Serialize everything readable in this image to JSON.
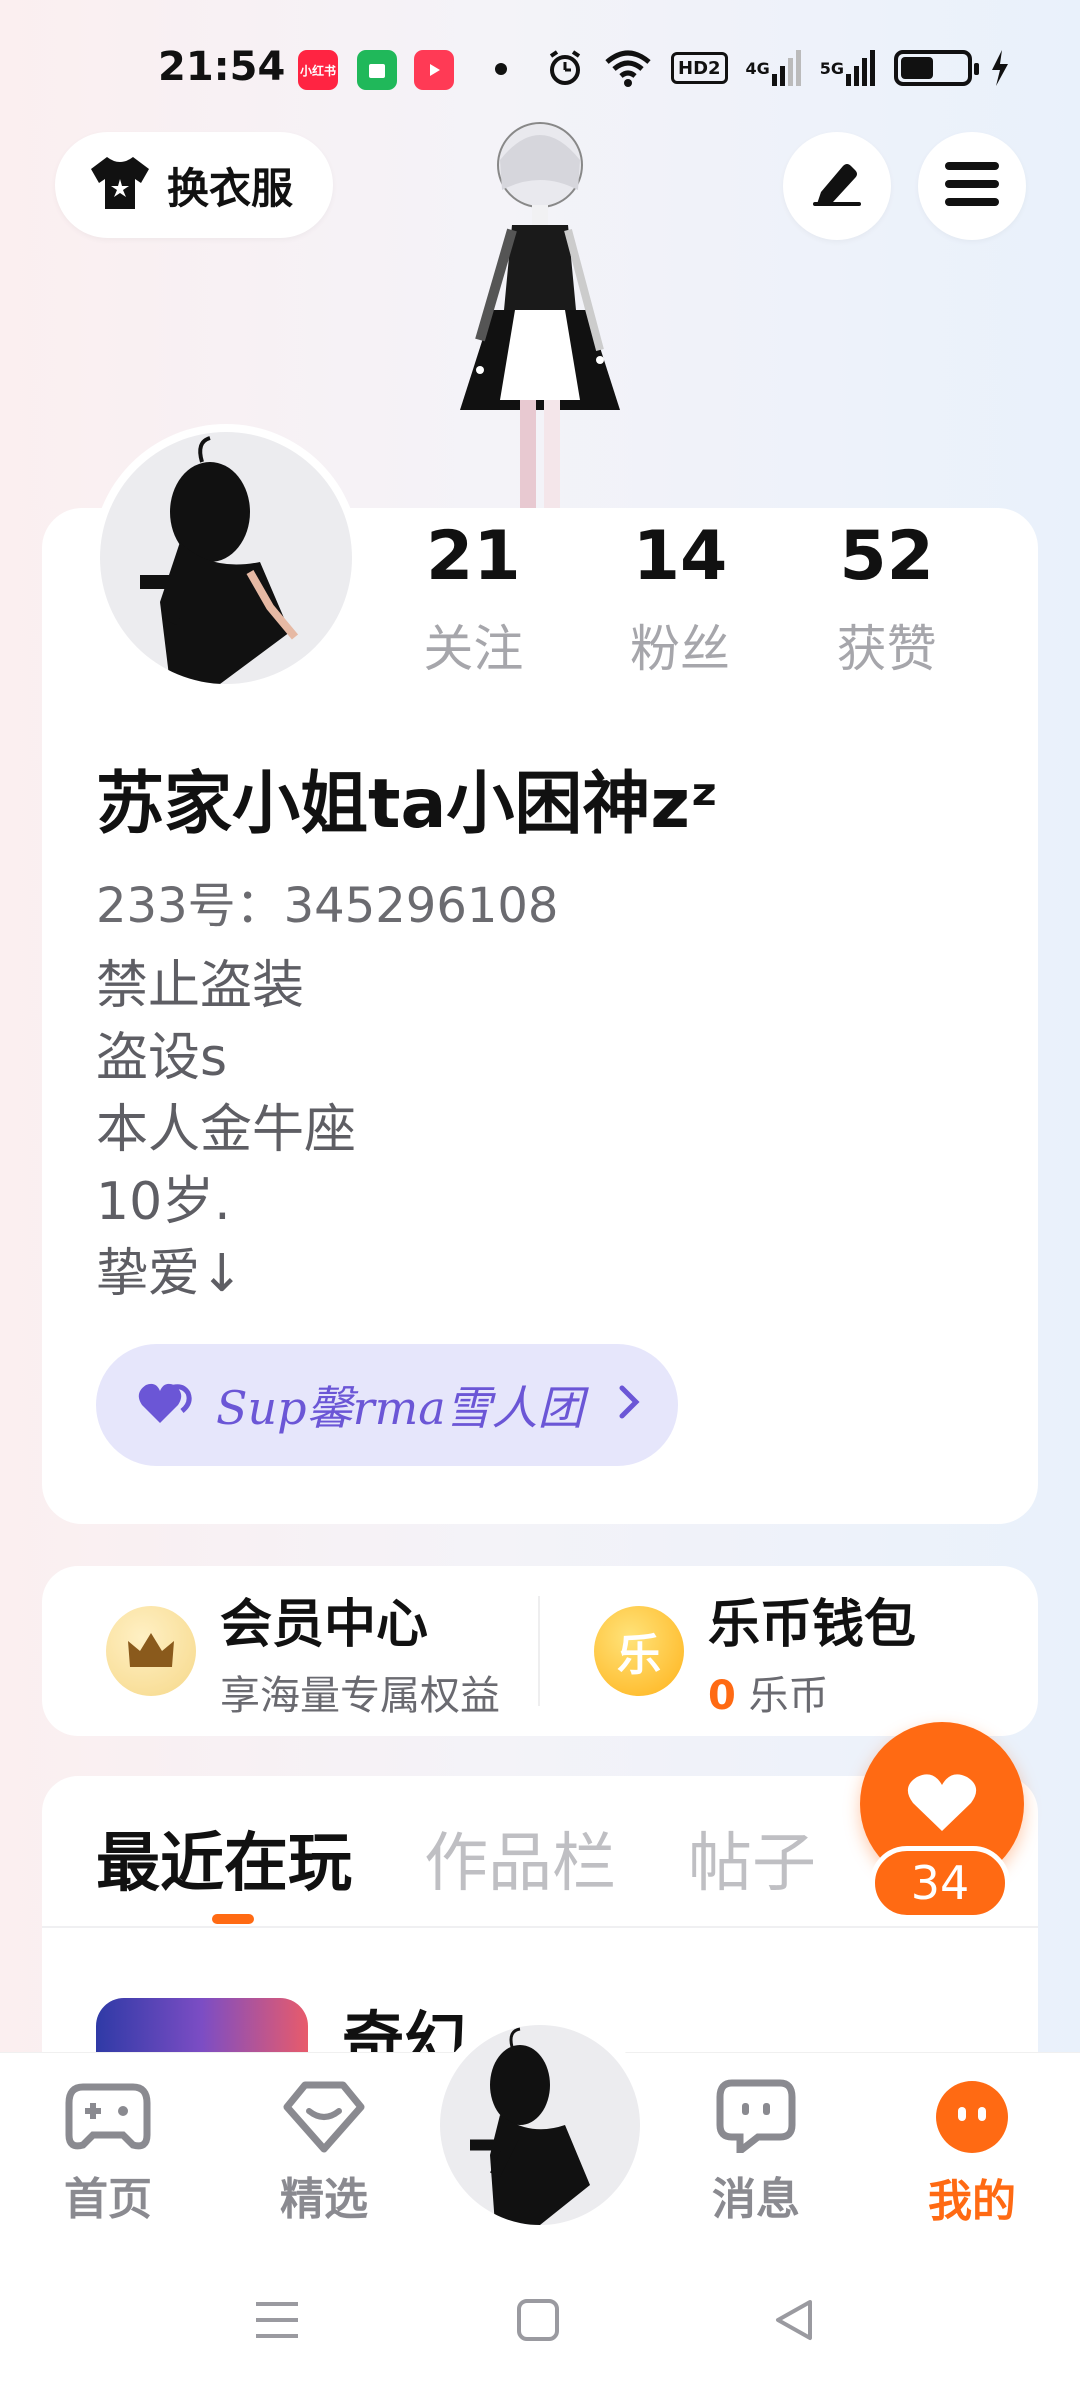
{
  "status_bar": {
    "time": "21:54",
    "app_icons": [
      {
        "name": "xiaohongshu",
        "label": "小红书",
        "color": "#ff2442"
      },
      {
        "name": "wechat-mini",
        "label": "",
        "color": "#20b85a"
      },
      {
        "name": "video-app",
        "label": "",
        "color": "#ff3a55"
      }
    ],
    "network_labels": {
      "hd": "HD2",
      "g4": "4G",
      "g5": "5G"
    }
  },
  "top_bar": {
    "outfit_label": "换衣服"
  },
  "profile": {
    "stats": [
      {
        "value": "21",
        "label": "关注"
      },
      {
        "value": "14",
        "label": "粉丝"
      },
      {
        "value": "52",
        "label": "获赞"
      }
    ],
    "username": "苏家小姐ta小困神zᶻ",
    "uid": "233号：345296108",
    "bio": [
      "禁止盗装",
      "盗设s",
      "本人金牛座",
      "10岁.",
      "挚爱↓"
    ],
    "group": {
      "name": "Sup馨rma雪人团"
    }
  },
  "member_center": {
    "title": "会员中心",
    "subtitle": "享海量专属权益"
  },
  "wallet": {
    "title": "乐币钱包",
    "amount": "0",
    "unit": "乐币",
    "coin_char": "乐"
  },
  "tabs": [
    {
      "label": "最近在玩",
      "active": true
    },
    {
      "label": "作品栏",
      "active": false
    },
    {
      "label": "帖子",
      "active": false
    }
  ],
  "recent_game": {
    "name": "奇幻"
  },
  "float_like": {
    "count": "34"
  },
  "bottom_nav": [
    {
      "label": "首页",
      "active": false
    },
    {
      "label": "精选",
      "active": false
    },
    {
      "label": "消息",
      "active": false
    },
    {
      "label": "我的",
      "active": true
    }
  ],
  "colors": {
    "accent": "#ff6a13",
    "group_bg": "#e6e6fb",
    "group_text": "#6b56d6"
  }
}
